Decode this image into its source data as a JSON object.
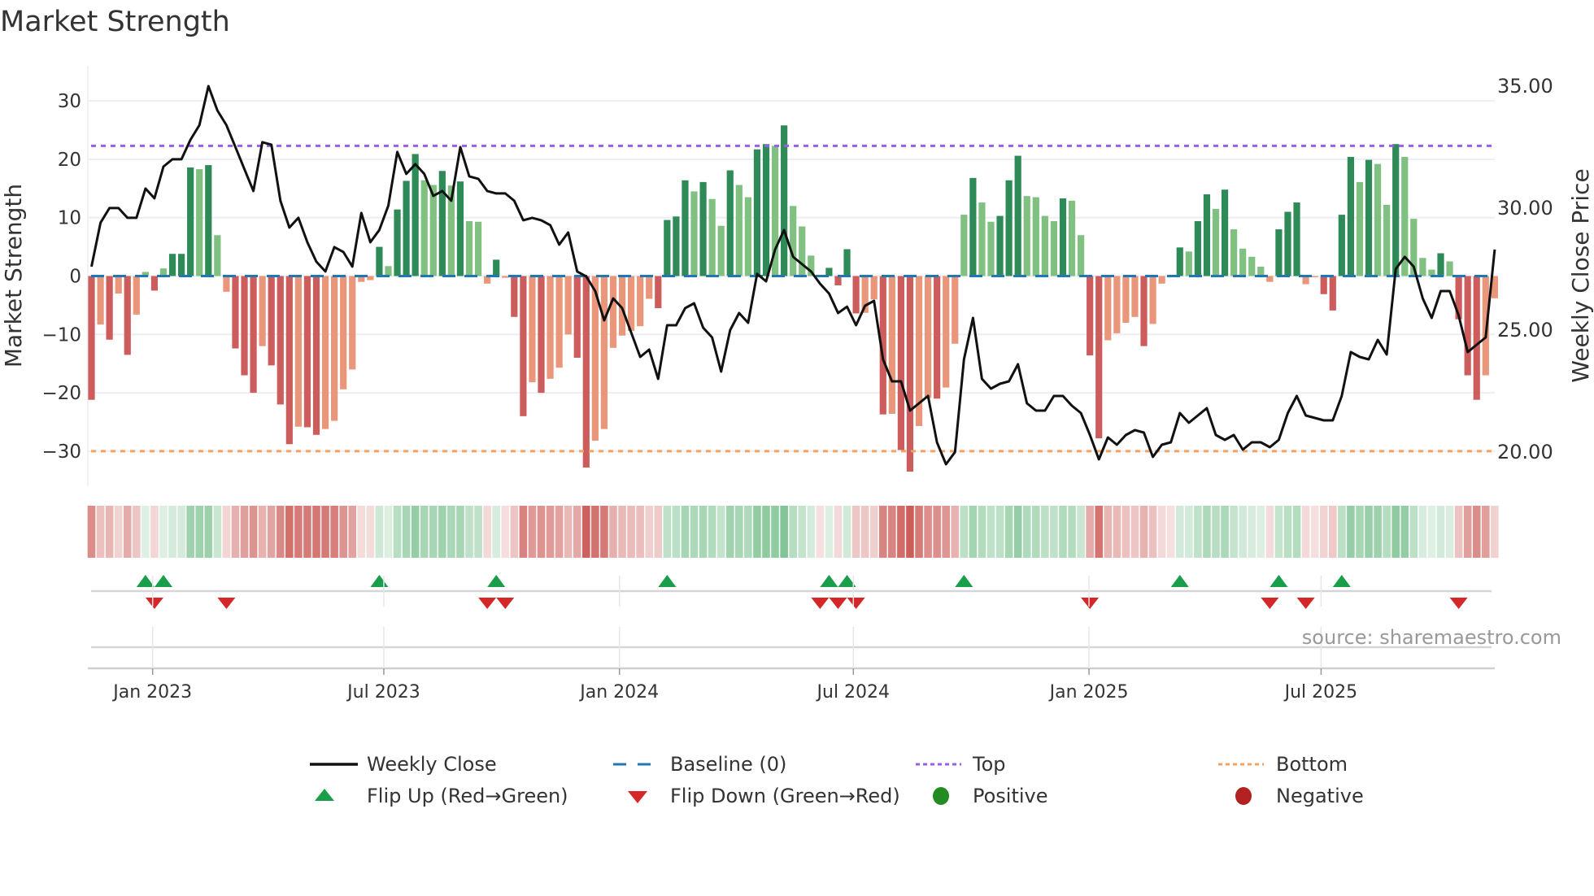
{
  "title": "Market Strength",
  "source": "source: sharemaestro.com",
  "chart_data": {
    "type": "bar",
    "title": "Market Strength",
    "ylabel": "Market Strength",
    "y2label": "Weekly Close Price",
    "ylim": [
      -36,
      36
    ],
    "y2lim": [
      18.6,
      35.83
    ],
    "yticks": [
      {
        "v": 30,
        "label": "30"
      },
      {
        "v": 20,
        "label": "20"
      },
      {
        "v": 10,
        "label": "10"
      },
      {
        "v": 0,
        "label": "0"
      },
      {
        "v": -10,
        "label": "−10"
      },
      {
        "v": -20,
        "label": "−20"
      },
      {
        "v": -30,
        "label": "−30"
      }
    ],
    "y2ticks": [
      {
        "v": 35,
        "label": "35.00"
      },
      {
        "v": 30,
        "label": "30.00"
      },
      {
        "v": 25,
        "label": "25.00"
      },
      {
        "v": 20,
        "label": "20.00"
      }
    ],
    "xticks": [
      {
        "week": 6.8,
        "label": "Jan 2023"
      },
      {
        "week": 32.5,
        "label": "Jul 2023"
      },
      {
        "week": 58.7,
        "label": "Jan 2024"
      },
      {
        "week": 84.7,
        "label": "Jul 2024"
      },
      {
        "week": 110.9,
        "label": "Jan 2025"
      },
      {
        "week": 136.7,
        "label": "Jul 2025"
      }
    ],
    "top_level": 22.3,
    "bottom_level": -30,
    "baseline": 0,
    "grid": true,
    "colors": {
      "pos_dark": "#2e8b57",
      "pos_light": "#80c080",
      "neg_dark": "#cd5c5c",
      "neg_light": "#e9967a",
      "close": "#111111",
      "baseline": "#1f77b4",
      "top": "#9b5de5",
      "bottom": "#f4a261",
      "flip_up": "#1a9e4a",
      "flip_down": "#d62728",
      "positive": "#228b22",
      "negative": "#b22222"
    },
    "strength": [
      -21.2,
      -8.3,
      -10.9,
      -3,
      -13.5,
      -6.6,
      0.7,
      -2.5,
      1.3,
      3.8,
      3.8,
      18.6,
      18.3,
      19,
      7,
      -2.7,
      -12.4,
      -17,
      -20,
      -12,
      -15.3,
      -22,
      -28.8,
      -25.8,
      -25.9,
      -27.2,
      -26.2,
      -24.8,
      -19.4,
      -16,
      -1,
      -0.7,
      5,
      1.7,
      11.4,
      16.3,
      20.9,
      16.4,
      15.6,
      18,
      15.5,
      16.2,
      9.4,
      9.3,
      -1.3,
      2.8,
      -0.3,
      -7,
      -24,
      -18.2,
      -20,
      -17.6,
      -15.7,
      -10,
      -14,
      -32.8,
      -28.2,
      -26.2,
      -12.3,
      -10.2,
      -9.4,
      -8.6,
      -3.9,
      -5.5,
      9.6,
      10.2,
      16.4,
      14.5,
      16.1,
      13.2,
      8.6,
      18.1,
      15.6,
      13.5,
      21.7,
      22.6,
      22.3,
      25.8,
      12,
      8.5,
      3.5,
      -0.1,
      1.4,
      -1.6,
      4.6,
      -6.4,
      -6.3,
      -4,
      -23.7,
      -23.6,
      -29.8,
      -33.5,
      -25.7,
      -20.9,
      -21,
      -19.1,
      -11.6,
      10.5,
      16.8,
      12.6,
      9.3,
      10.3,
      16.4,
      20.6,
      13.7,
      13.5,
      10.3,
      9.4,
      13.3,
      12.9,
      7,
      -13.6,
      -27.8,
      -11,
      -9.8,
      -8,
      -7,
      -12,
      -8.2,
      -1.3,
      -0.2,
      4.9,
      4.2,
      9.4,
      14,
      11.5,
      14.8,
      8,
      4.7,
      3.3,
      1.6,
      -1,
      8,
      11,
      12.6,
      -1.4,
      -0.2,
      -3.1,
      -5.9,
      10.5,
      20.4,
      16.1,
      19.9,
      19.2,
      12.2,
      22.6,
      20.4,
      9.8,
      3.1,
      1.1,
      3.9,
      2.5,
      -7.4,
      -17,
      -21.2,
      -17,
      -3.8
    ],
    "weekly_close": [
      27.6,
      29.4,
      30.0,
      30.0,
      29.6,
      29.6,
      30.8,
      30.4,
      31.7,
      32.0,
      32.0,
      32.8,
      33.4,
      35.0,
      34.0,
      33.4,
      32.5,
      31.6,
      30.7,
      32.7,
      32.6,
      30.3,
      29.2,
      29.6,
      28.6,
      27.8,
      27.4,
      28.4,
      28.2,
      27.6,
      29.8,
      28.6,
      29.1,
      30.1,
      32.3,
      31.4,
      31.8,
      31.4,
      30.5,
      30.7,
      30.3,
      32.5,
      31.3,
      31.2,
      30.7,
      30.6,
      30.6,
      30.3,
      29.5,
      29.6,
      29.5,
      29.3,
      28.5,
      29.0,
      27.4,
      27.2,
      26.6,
      25.4,
      26.3,
      25.9,
      24.9,
      23.9,
      24.2,
      23.0,
      25.2,
      25.2,
      25.9,
      26.1,
      25.1,
      24.7,
      23.3,
      25.0,
      25.7,
      25.3,
      27.3,
      27.0,
      28.3,
      29.1,
      28.0,
      27.7,
      27.4,
      26.9,
      26.5,
      25.7,
      25.96,
      25.2,
      26.0,
      26.2,
      23.8,
      22.9,
      22.9,
      21.7,
      22.0,
      22.3,
      20.4,
      19.5,
      20.0,
      23.8,
      25.5,
      23.0,
      22.6,
      22.8,
      22.9,
      23.6,
      22.0,
      21.7,
      21.7,
      22.3,
      22.3,
      21.9,
      21.6,
      20.7,
      19.7,
      20.6,
      20.3,
      20.7,
      20.9,
      20.8,
      19.8,
      20.3,
      20.4,
      21.6,
      21.2,
      21.5,
      21.8,
      20.7,
      20.5,
      20.7,
      20.1,
      20.4,
      20.4,
      20.2,
      20.5,
      21.6,
      22.3,
      21.5,
      21.4,
      21.3,
      21.3,
      22.3,
      24.1,
      23.9,
      23.8,
      24.6,
      24.0,
      27.5,
      28.0,
      27.6,
      26.3,
      25.5,
      26.6,
      26.6,
      25.6,
      24.1,
      24.4,
      24.7,
      28.3
    ],
    "legend": [
      {
        "key": "close",
        "label": "Weekly Close"
      },
      {
        "key": "baseline",
        "label": "Baseline (0)"
      },
      {
        "key": "top",
        "label": "Top"
      },
      {
        "key": "bottom",
        "label": "Bottom"
      },
      {
        "key": "flip_up",
        "label": "Flip Up (Red→Green)"
      },
      {
        "key": "flip_down",
        "label": "Flip Down (Green→Red)"
      },
      {
        "key": "positive",
        "label": "Positive"
      },
      {
        "key": "negative",
        "label": "Negative"
      }
    ],
    "legend_position": "bottom"
  }
}
